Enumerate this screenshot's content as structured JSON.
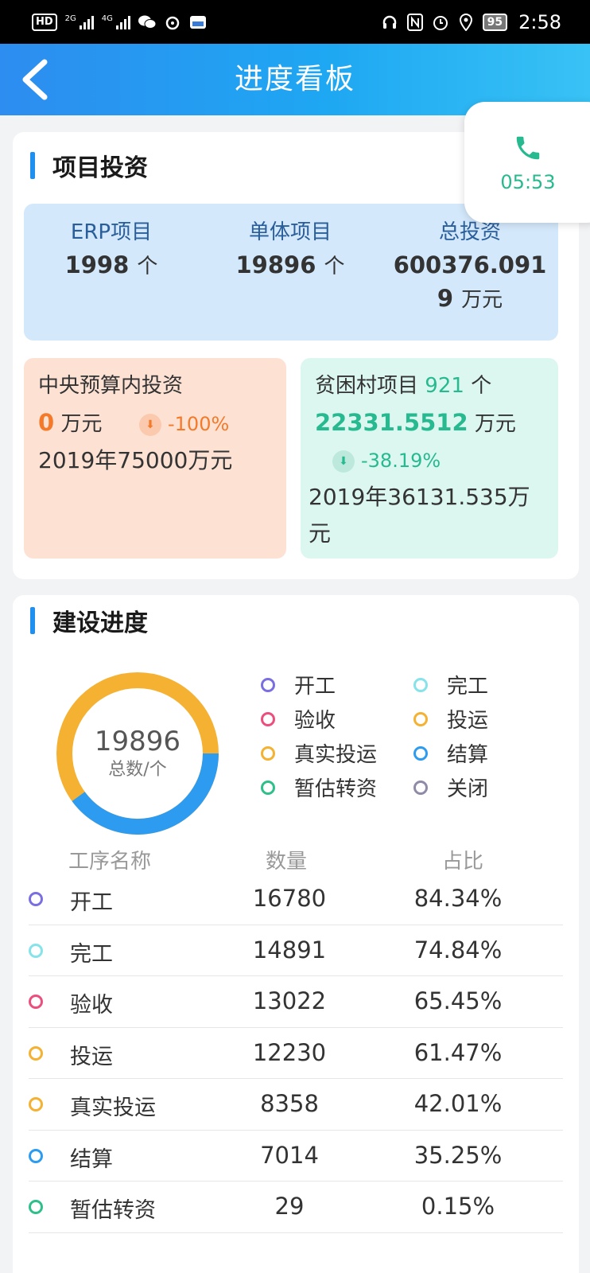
{
  "status_bar": {
    "hd_badge": "HD",
    "network_1": "2G",
    "network_2": "4G",
    "battery": "95",
    "time": "2:58"
  },
  "header": {
    "title": "进度看板"
  },
  "call_widget": {
    "duration": "05:53"
  },
  "investment": {
    "section_title": "项目投资",
    "erp": {
      "label": "ERP项目",
      "value": "1998",
      "unit": "个"
    },
    "single": {
      "label": "单体项目",
      "value": "19896",
      "unit": "个"
    },
    "total": {
      "label": "总投资",
      "value_line1": "600376.091",
      "value_line2": "9",
      "unit": "万元"
    },
    "central": {
      "title": "中央预算内投资",
      "value": "0",
      "unit": "万元",
      "change": "-100%",
      "compare": "2019年75000万元"
    },
    "poor_village": {
      "title": "贫困村项目",
      "count": "921",
      "count_unit": "个",
      "value": "22331.5512",
      "unit": "万元",
      "change": "-38.19%",
      "compare_line1": "2019年36131.535万",
      "compare_line2": "元"
    }
  },
  "progress": {
    "section_title": "建设进度",
    "donut_total": "19896",
    "donut_caption": "总数/个",
    "legend": [
      {
        "label": "开工",
        "color": "#7a6fe0"
      },
      {
        "label": "完工",
        "color": "#86e3ea"
      },
      {
        "label": "验收",
        "color": "#ec4f7d"
      },
      {
        "label": "投运",
        "color": "#f5b132"
      },
      {
        "label": "真实投运",
        "color": "#f5b132"
      },
      {
        "label": "结算",
        "color": "#2d9cf0"
      },
      {
        "label": "暂估转资",
        "color": "#2fbf8a"
      },
      {
        "label": "关闭",
        "color": "#8f8aa6"
      }
    ],
    "table": {
      "col_name": "工序名称",
      "col_qty": "数量",
      "col_pct": "占比",
      "rows": [
        {
          "name": "开工",
          "qty": "16780",
          "pct": "84.34%",
          "color": "#7a6fe0"
        },
        {
          "name": "完工",
          "qty": "14891",
          "pct": "74.84%",
          "color": "#86e3ea"
        },
        {
          "name": "验收",
          "qty": "13022",
          "pct": "65.45%",
          "color": "#ec4f7d"
        },
        {
          "name": "投运",
          "qty": "12230",
          "pct": "61.47%",
          "color": "#f5b132"
        },
        {
          "name": "真实投运",
          "qty": "8358",
          "pct": "42.01%",
          "color": "#f5b132"
        },
        {
          "name": "结算",
          "qty": "7014",
          "pct": "35.25%",
          "color": "#2d9cf0"
        },
        {
          "name": "暂估转资",
          "qty": "29",
          "pct": "0.15%",
          "color": "#2fbf8a"
        }
      ]
    }
  }
}
